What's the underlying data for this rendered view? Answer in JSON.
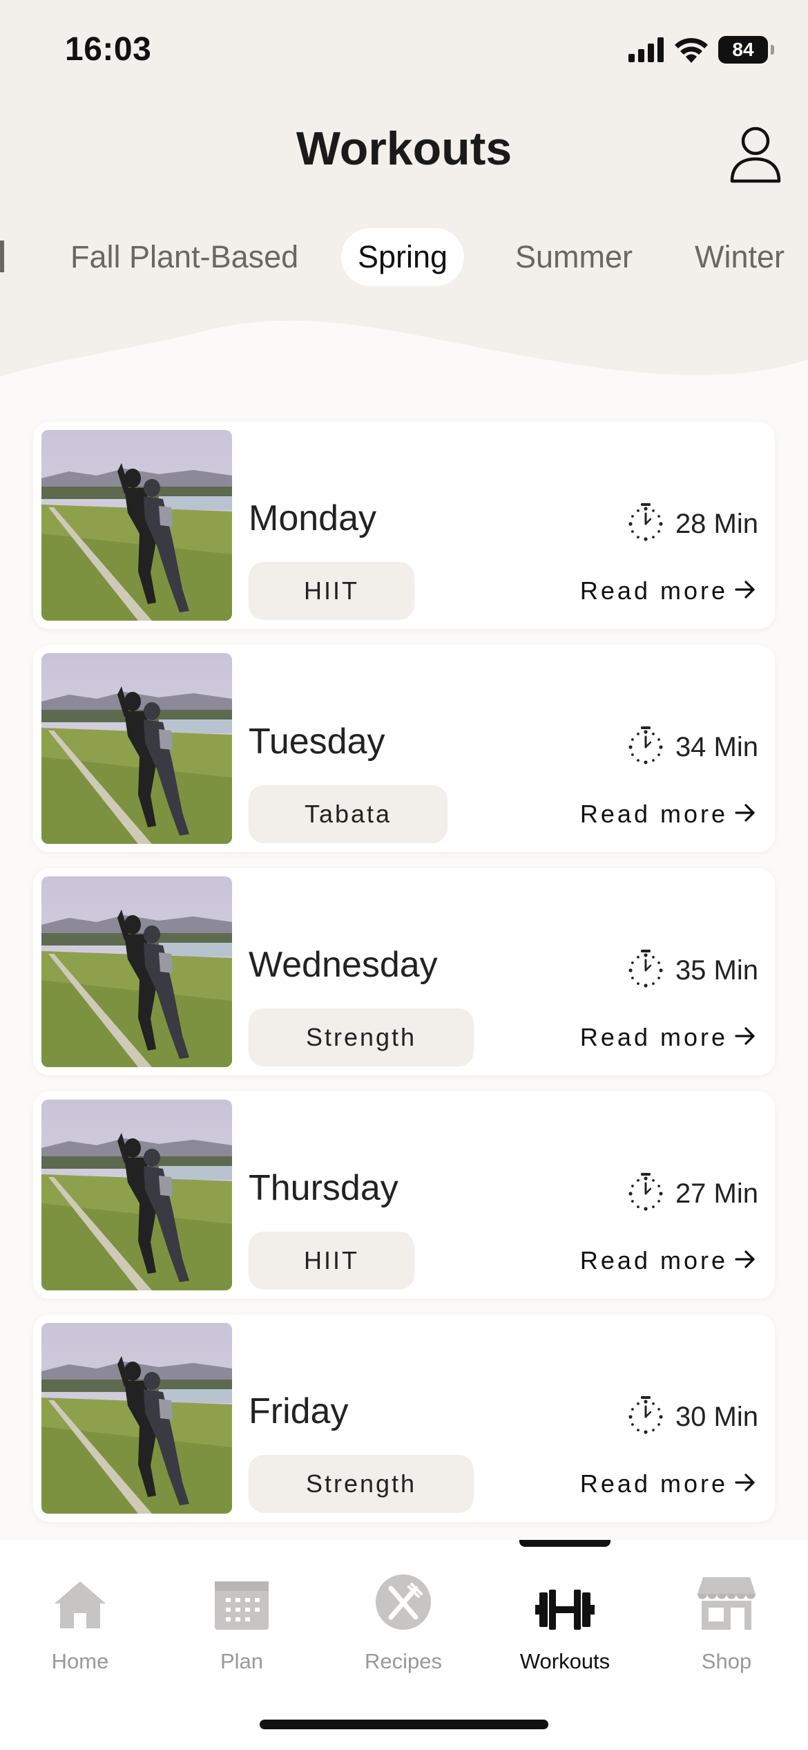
{
  "status_bar": {
    "time": "16:03",
    "battery": "84"
  },
  "header": {
    "title": "Workouts"
  },
  "tabs": [
    {
      "label": "Fall Plant-Based",
      "active": false
    },
    {
      "label": "Spring",
      "active": true
    },
    {
      "label": "Summer",
      "active": false
    },
    {
      "label": "Winter",
      "active": false
    }
  ],
  "workouts": [
    {
      "day": "Monday",
      "tag": "HIIT",
      "duration": "28 Min",
      "read_more": "Read more"
    },
    {
      "day": "Tuesday",
      "tag": "Tabata",
      "duration": "34 Min",
      "read_more": "Read more"
    },
    {
      "day": "Wednesday",
      "tag": "Strength",
      "duration": "35 Min",
      "read_more": "Read more"
    },
    {
      "day": "Thursday",
      "tag": "HIIT",
      "duration": "27 Min",
      "read_more": "Read more"
    },
    {
      "day": "Friday",
      "tag": "Strength",
      "duration": "30 Min",
      "read_more": "Read more"
    }
  ],
  "bottom_nav": [
    {
      "label": "Home",
      "icon": "home-icon",
      "active": false
    },
    {
      "label": "Plan",
      "icon": "calendar-icon",
      "active": false
    },
    {
      "label": "Recipes",
      "icon": "utensils-icon",
      "active": false
    },
    {
      "label": "Workouts",
      "icon": "dumbbell-icon",
      "active": true
    },
    {
      "label": "Shop",
      "icon": "store-icon",
      "active": false
    }
  ],
  "colors": {
    "header_bg": "#f3efea",
    "page_bg": "#fbfaf9",
    "tag_bg": "#f2eee9",
    "inactive_nav": "#c7c5c3",
    "active": "#111111"
  }
}
